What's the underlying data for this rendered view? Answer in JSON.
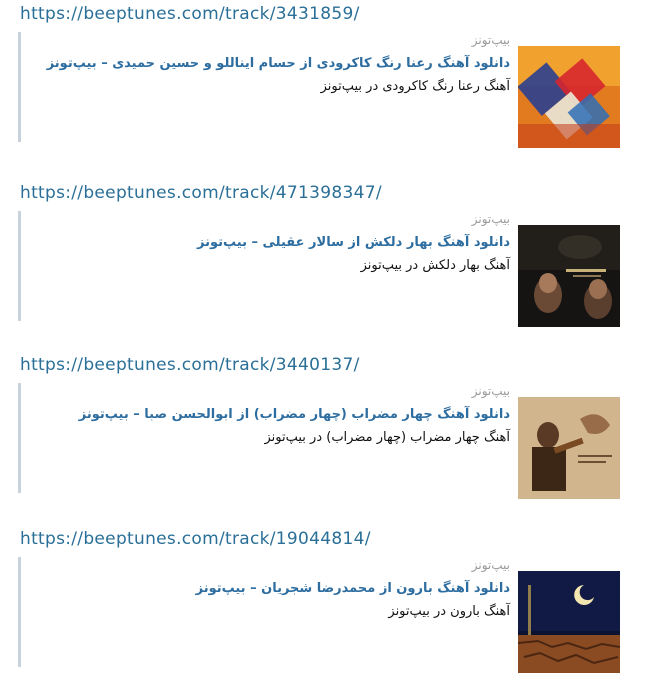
{
  "entries": [
    {
      "url": "https://beeptunes.com/track/3431859/",
      "site": "بیپ‌تونز",
      "title": "دانلود آهنگ رعنا رنگ کاکرودی از حسام ایناللو و حسین حمیدی – بیپ‌تونز",
      "description": "آهنگ رعنا رنگ کاکرودی در بیپ‌تونز",
      "thumbnail": "album-cover-colored-squares"
    },
    {
      "url": "https://beeptunes.com/track/471398347/",
      "site": "بیپ‌تونز",
      "title": "دانلود آهنگ بهار دلکش از سالار عقیلی – بیپ‌تونز",
      "description": "آهنگ بهار دلکش در بیپ‌تونز",
      "thumbnail": "album-cover-two-musicians"
    },
    {
      "url": "https://beeptunes.com/track/3440137/",
      "site": "بیپ‌تونز",
      "title": "دانلود آهنگ چهار مضراب (چهار مضراب) از ابوالحسن صبا – بیپ‌تونز",
      "description": "آهنگ چهار مضراب (چهار مضراب) در بیپ‌تونز",
      "thumbnail": "album-cover-violinist"
    },
    {
      "url": "https://beeptunes.com/track/19044814/",
      "site": "بیپ‌تونز",
      "title": "دانلود آهنگ بارون از محمدرضا شجریان – بیپ‌تونز",
      "description": "آهنگ بارون در بیپ‌تونز",
      "thumbnail": "album-cover-moon-desert"
    }
  ]
}
